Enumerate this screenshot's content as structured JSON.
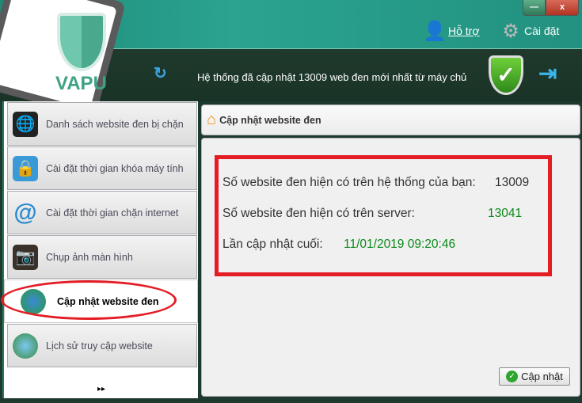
{
  "app": {
    "logo_text": "VAPU",
    "minimize": "—",
    "close": "x"
  },
  "header": {
    "support": "Hỗ trợ",
    "settings": "Cài đặt",
    "status": "Hệ thống đã cập nhật 13009 web đen mới nhất từ máy chủ"
  },
  "sidebar": {
    "items": [
      {
        "label": "Danh sách website đen bị chặn",
        "icon": "globe-folder-icon"
      },
      {
        "label": "Cài đặt thời gian khóa máy tính",
        "icon": "monitor-lock-icon"
      },
      {
        "label": "Cài đặt thời gian chặn internet",
        "icon": "at-icon"
      },
      {
        "label": "Chụp ảnh màn hình",
        "icon": "camera-icon"
      },
      {
        "label": "Cập nhật website đen",
        "icon": "globe-update-icon"
      },
      {
        "label": "Lịch sử truy cập website",
        "icon": "globe-computer-icon"
      }
    ],
    "more": "▸▸"
  },
  "main": {
    "title": "Cập nhật website đen",
    "system_label": "Số website đen hiện có trên hệ thống của bạn:",
    "system_value": "13009",
    "server_label": "Số website đen hiện có trên server:",
    "server_value": "13041",
    "last_label": "Lần cập nhật cuối:",
    "last_value": "11/01/2019 09:20:46",
    "update_button": "Cập nhật"
  }
}
